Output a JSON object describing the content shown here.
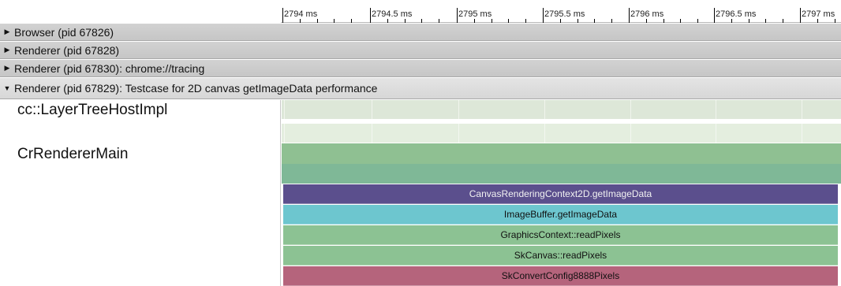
{
  "ruler": {
    "ticks": [
      "2794 ms",
      "2794.5 ms",
      "2795 ms",
      "2795.5 ms",
      "2796 ms",
      "2796.5 ms",
      "2797 ms"
    ]
  },
  "processes": [
    {
      "label": "Browser (pid 67826)",
      "expanded": false
    },
    {
      "label": "Renderer (pid 67828)",
      "expanded": false
    },
    {
      "label": "Renderer (pid 67830): chrome://tracing",
      "expanded": false
    },
    {
      "label": "Renderer (pid 67829): Testcase for 2D canvas getImageData performance",
      "expanded": true
    }
  ],
  "threads": {
    "compositor": {
      "label": "cc::LayerTreeHostImpl",
      "colors": [
        "#dde7d8",
        "#ffffff",
        "#e4eedf"
      ]
    },
    "main": {
      "label": "CrRendererMain",
      "colors": [
        "#8fc092",
        "#7fb897"
      ]
    }
  },
  "slices": [
    {
      "name": "CanvasRenderingContext2D.getImageData",
      "color": "#5b4f8d",
      "text_color": "#f2f2f2"
    },
    {
      "name": "ImageBuffer.getImageData",
      "color": "#6dc6cf",
      "text_color": "#111111"
    },
    {
      "name": "GraphicsContext::readPixels",
      "color": "#8cc293",
      "text_color": "#111111"
    },
    {
      "name": "SkCanvas::readPixels",
      "color": "#8cc293",
      "text_color": "#111111"
    },
    {
      "name": "SkConvertConfig8888Pixels",
      "color": "#b5647c",
      "text_color": "#111111"
    }
  ]
}
